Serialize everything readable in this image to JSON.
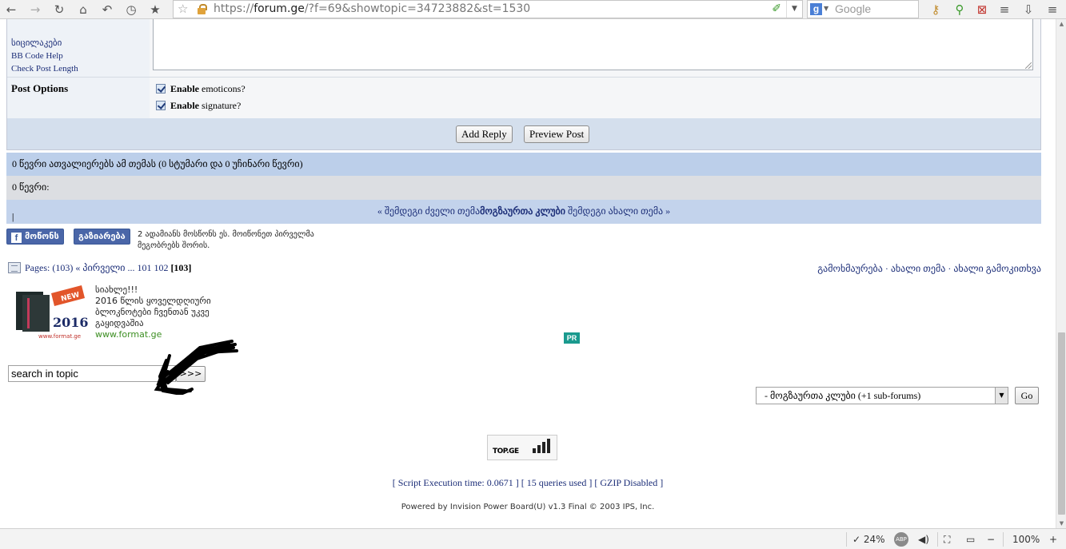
{
  "browser": {
    "url_prefix": "https://",
    "url_host": "forum.ge",
    "url_path": "/?f=69&showtopic=34723882&st=1530",
    "search_placeholder": "Google",
    "zoom": "100%",
    "cpu": "24%",
    "abp": "ABP"
  },
  "reply_form": {
    "links": [
      "სიცილაკები",
      "BB Code Help",
      "Check Post Length"
    ],
    "post_options_label": "Post Options",
    "option1_bold": "Enable",
    "option1_rest": "emoticons?",
    "option2_bold": "Enable",
    "option2_rest": "signature?",
    "add_reply": "Add Reply",
    "preview": "Preview Post"
  },
  "info": {
    "readers": "0 წევრი ათვალიერებს ამ თემას (0 სტუმარი და 0 უჩინარი წევრი)",
    "members": "0 წევრი:",
    "prev_topic": "« შემდეგი ძველი თემა",
    "forum_name": "მოგზაურთა კლუბი",
    "next_topic": "შემდეგი ახალი თემა »",
    "sep1": " | ",
    "sep2": " |"
  },
  "facebook": {
    "like": "მოწონს",
    "share": "გაზიარება",
    "text": "2 ადამიანს მოსწონს ეს. მოიწონეთ პირველმა მეგობრებს შორის."
  },
  "pages": {
    "label": "Pages:",
    "count": "(103)",
    "first": "« პირველი",
    "ellipsis": "...",
    "p1": "101",
    "p2": "102",
    "current": "[103]",
    "topic_links": "გამოხმაურება · ახალი თემა · ახალი გამოკითხვა"
  },
  "ad": {
    "title": "სიახლე!!!",
    "body": "2016 წლის ყოველდღიური ბლოკნოტები ჩვენთან უკვე გაყიდვაშია",
    "url": "www.format.ge",
    "img_new": "NEW",
    "img_year": "2016",
    "img_site": "www.format.ge",
    "pr": "PR"
  },
  "search": {
    "value": "search in topic",
    "go": ">>>"
  },
  "jump": {
    "selected": "- მოგზაურთა კლუბი (+1 sub-forums)",
    "go": "Go"
  },
  "footer": {
    "topge": "TOP.GE",
    "stats": "[ Script Execution time: 0.0671 ]   [ 15 queries used ]   [ GZIP Disabled ]",
    "powered": "Powered by Invision Power Board(U) v1.3 Final © 2003  IPS, Inc."
  }
}
